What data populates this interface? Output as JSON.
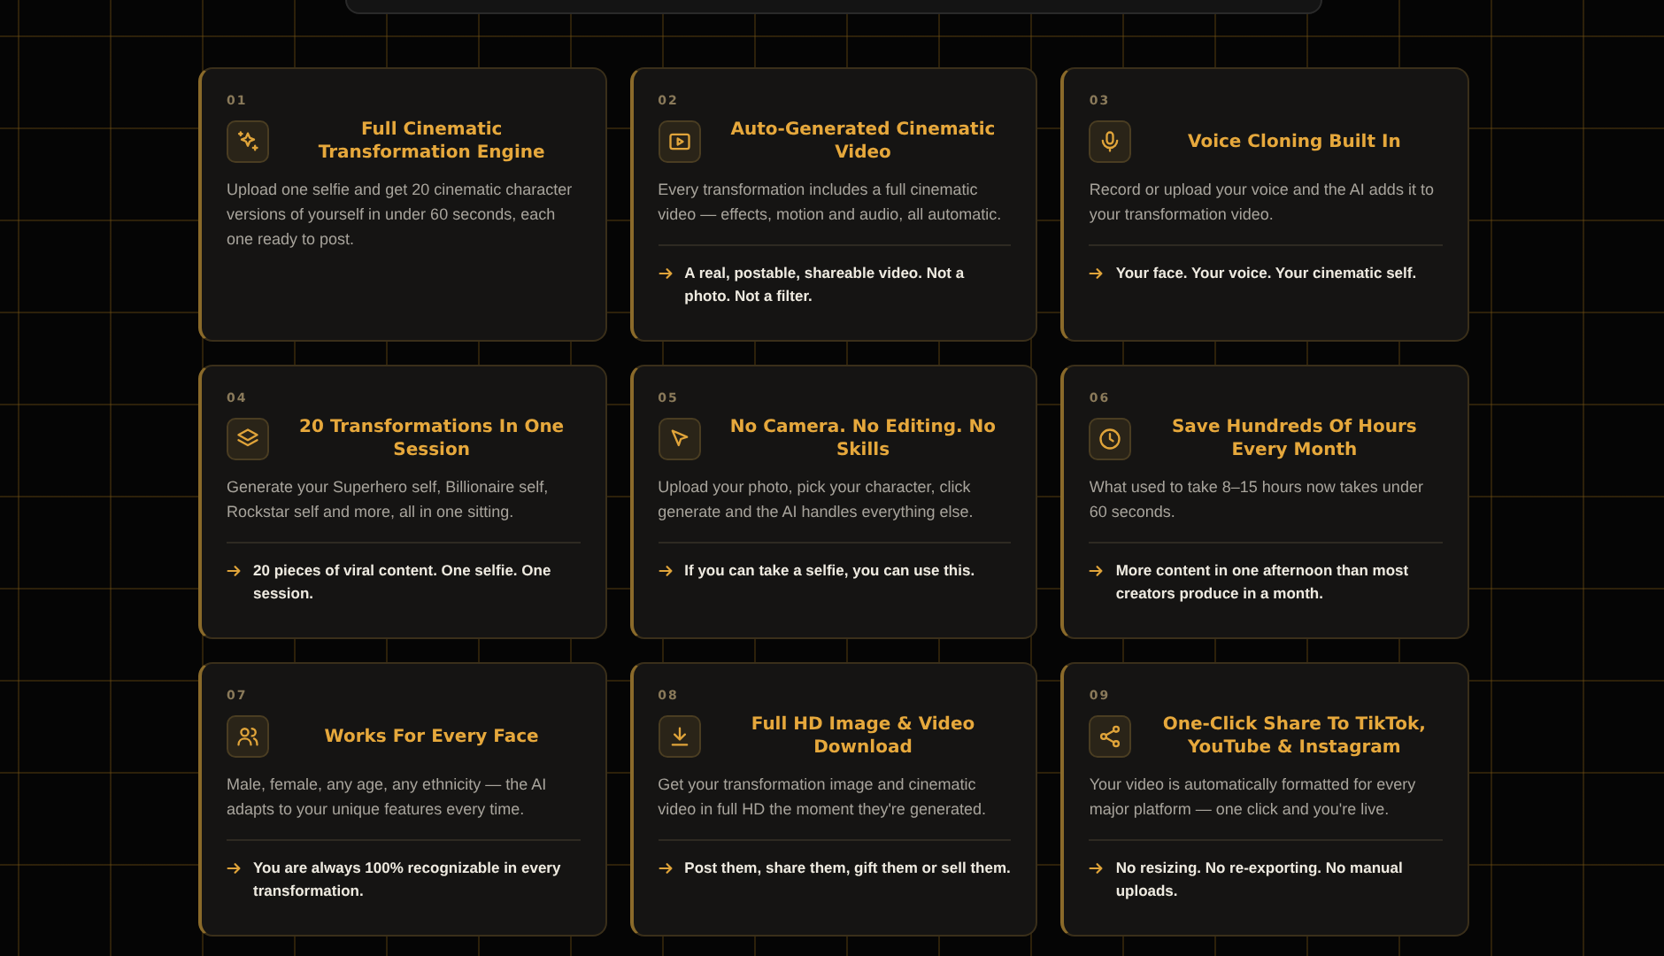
{
  "cards": [
    {
      "number": "01",
      "title": "Full Cinematic Transformation Engine",
      "body": "Upload one selfie and get 20 cinematic character versions of yourself in under 60 seconds, each one ready to post."
    },
    {
      "number": "02",
      "title": "Auto-Generated Cinematic Video",
      "body": "Every transformation includes a full cinematic video — effects, motion and audio, all automatic.",
      "highlight": "A real, postable, shareable video. Not a photo. Not a filter."
    },
    {
      "number": "03",
      "title": "Voice Cloning Built In",
      "body": "Record or upload your voice and the AI adds it to your transformation video.",
      "highlight": "Your face. Your voice. Your cinematic self."
    },
    {
      "number": "04",
      "title": "20 Transformations In One Session",
      "body": "Generate your Superhero self, Billionaire self, Rockstar self and more, all in one sitting.",
      "highlight": "20 pieces of viral content. One selfie. One session."
    },
    {
      "number": "05",
      "title": "No Camera. No Editing. No Skills",
      "body": "Upload your photo, pick your character, click generate and the AI handles everything else.",
      "highlight": "If you can take a selfie, you can use this."
    },
    {
      "number": "06",
      "title": "Save Hundreds Of Hours Every Month",
      "body": "What used to take 8–15 hours now takes under 60 seconds.",
      "highlight": "More content in one afternoon than most creators produce in a month."
    },
    {
      "number": "07",
      "title": "Works For Every Face",
      "body": "Male, female, any age, any ethnicity — the AI adapts to your unique features every time.",
      "highlight": "You are always 100% recognizable in every transformation."
    },
    {
      "number": "08",
      "title": "Full HD Image & Video Download",
      "body": "Get your transformation image and cinematic video in full HD the moment they're generated.",
      "highlight": "Post them, share them, gift them or sell them."
    },
    {
      "number": "09",
      "title": "One-Click Share To TikTok, YouTube & Instagram",
      "body": "Your video is automatically formatted for every major platform — one click and you're live.",
      "highlight": "No resizing. No re-exporting. No manual uploads."
    }
  ]
}
